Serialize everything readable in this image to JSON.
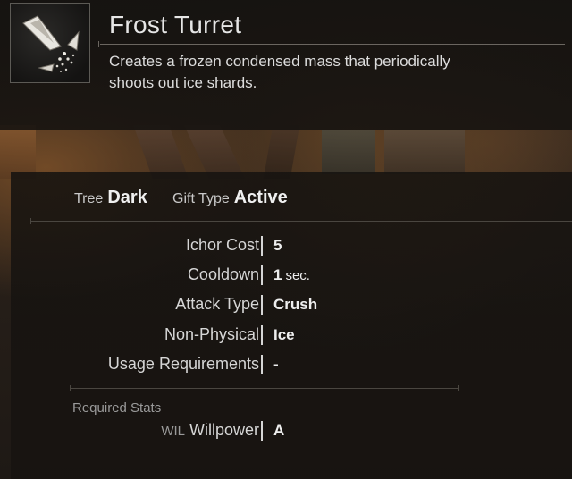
{
  "skill": {
    "name": "Frost Turret",
    "description": "Creates a frozen condensed mass that periodically shoots out ice shards.",
    "icon": "ice-shards-icon"
  },
  "meta": {
    "tree_label": "Tree",
    "tree_value": "Dark",
    "gift_type_label": "Gift Type",
    "gift_type_value": "Active"
  },
  "stats": [
    {
      "label": "Ichor Cost",
      "value": "5",
      "unit": ""
    },
    {
      "label": "Cooldown",
      "value": "1",
      "unit": "sec."
    },
    {
      "label": "Attack Type",
      "value": "Crush",
      "unit": ""
    },
    {
      "label": "Non-Physical",
      "value": "Ice",
      "unit": ""
    },
    {
      "label": "Usage Requirements",
      "value": "-",
      "unit": ""
    }
  ],
  "required_stats": {
    "title": "Required Stats",
    "items": [
      {
        "abbr": "WIL",
        "label": "Willpower",
        "value": "A"
      }
    ]
  },
  "colors": {
    "panel_bg": "#161310",
    "text_primary": "#e6e6e6",
    "text_secondary": "#9a9a9a"
  }
}
